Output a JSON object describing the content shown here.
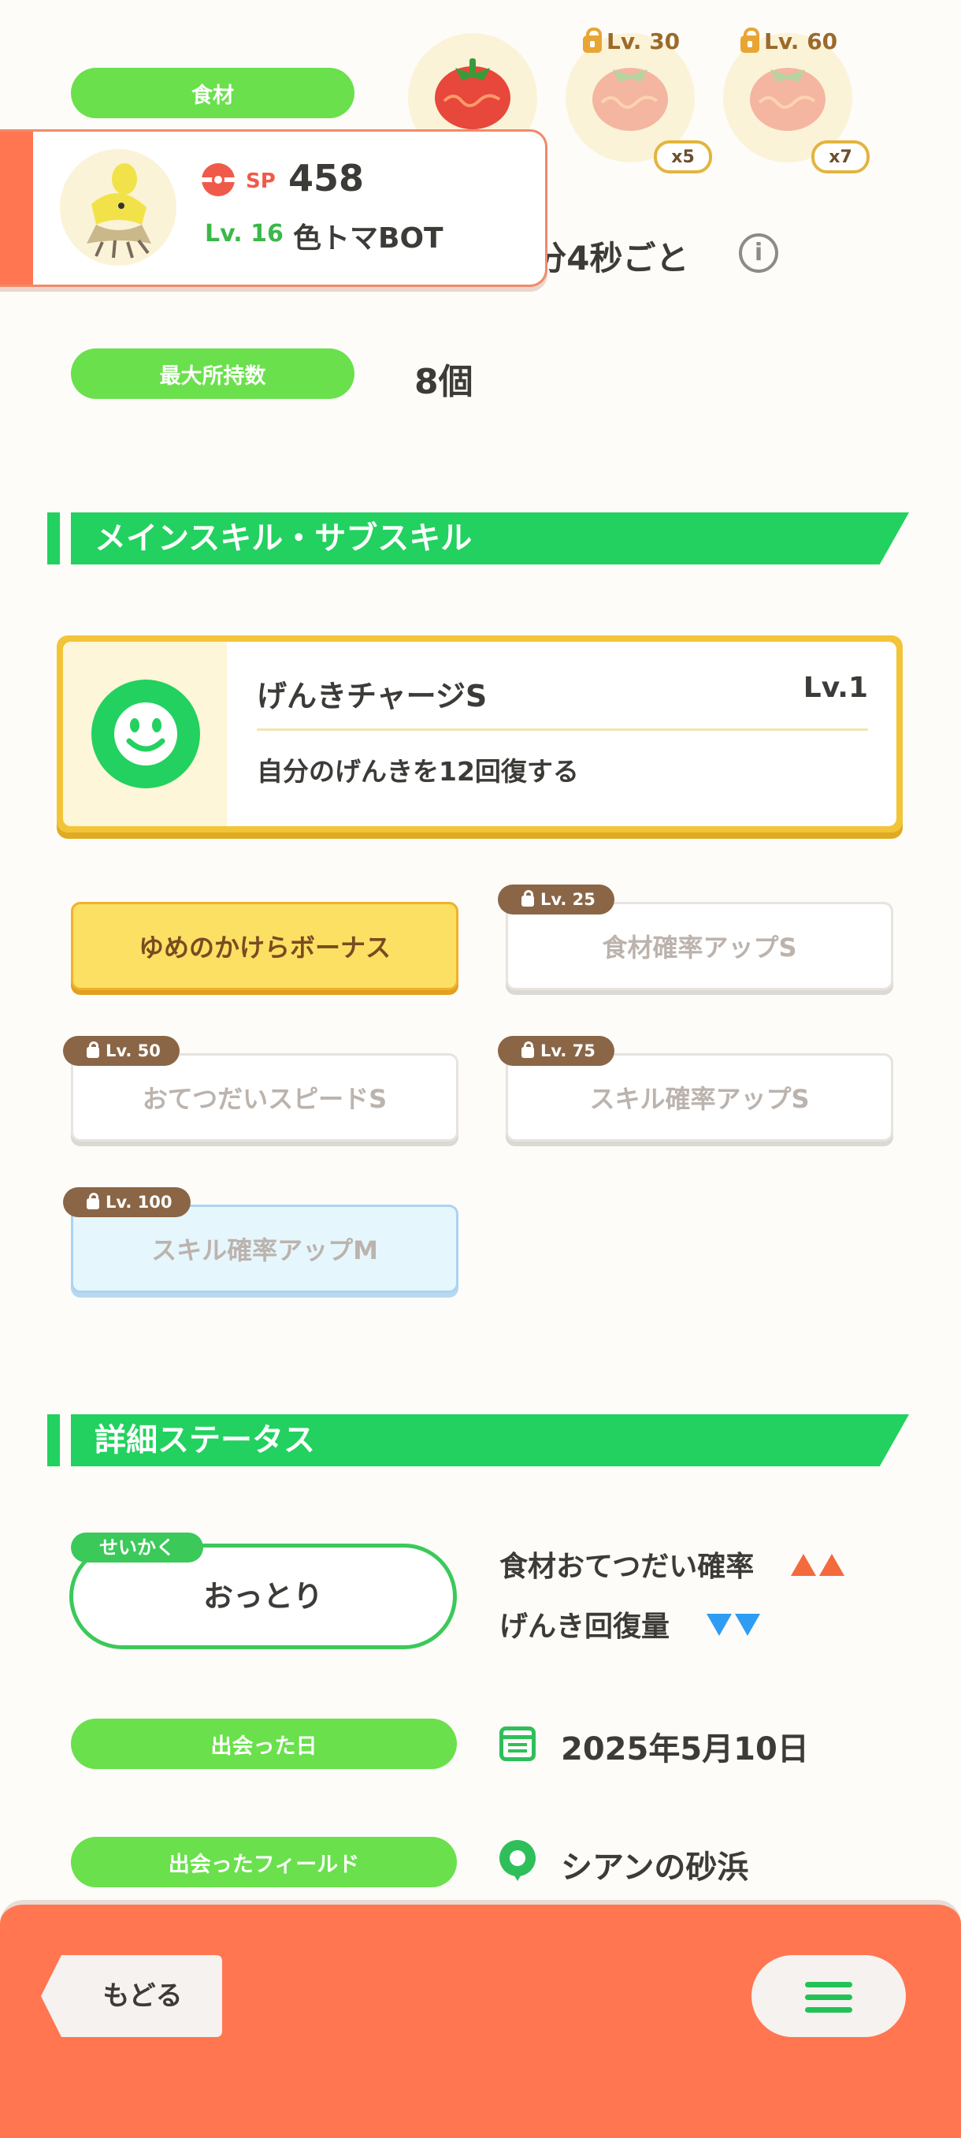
{
  "ingredients": {
    "label": "食材",
    "slots": [
      {
        "level": "",
        "qty": ""
      },
      {
        "level": "Lv. 30",
        "qty": "x5"
      },
      {
        "level": "Lv. 60",
        "qty": "x7"
      }
    ],
    "frequency_text": "1分4秒ごと"
  },
  "pokemon_card": {
    "sp_label": "SP",
    "sp_value": "458",
    "level": "Lv. 16",
    "nickname": "色トマBOT"
  },
  "max_carry": {
    "label": "最大所持数",
    "value": "8個"
  },
  "skills_section": {
    "title": "メインスキル・サブスキル",
    "main_skill": {
      "name": "げんきチャージS",
      "level": "Lv.1",
      "description": "自分のげんきを12回復する"
    },
    "sub_skills": [
      {
        "name": "ゆめのかけらボーナス",
        "lock_level": ""
      },
      {
        "name": "食材確率アップS",
        "lock_level": "Lv. 25"
      },
      {
        "name": "おてつだいスピードS",
        "lock_level": "Lv. 50"
      },
      {
        "name": "スキル確率アップS",
        "lock_level": "Lv. 75"
      },
      {
        "name": "スキル確率アップM",
        "lock_level": "Lv. 100"
      }
    ]
  },
  "details_section": {
    "title": "詳細ステータス",
    "nature": {
      "tag": "せいかく",
      "value": "おっとり"
    },
    "nature_effects": [
      {
        "label": "食材おてつだい確率",
        "direction": "up"
      },
      {
        "label": "げんき回復量",
        "direction": "down"
      }
    ],
    "met_date": {
      "label": "出会った日",
      "value": "2025年5月10日"
    },
    "met_field": {
      "label": "出会ったフィールド",
      "value": "シアンの砂浜"
    }
  },
  "footer": {
    "back_label": "もどる"
  },
  "colors": {
    "green": "#22d15f",
    "pill_green": "#6ae04c",
    "footer": "#ff7650",
    "gold": "#f2c438"
  }
}
